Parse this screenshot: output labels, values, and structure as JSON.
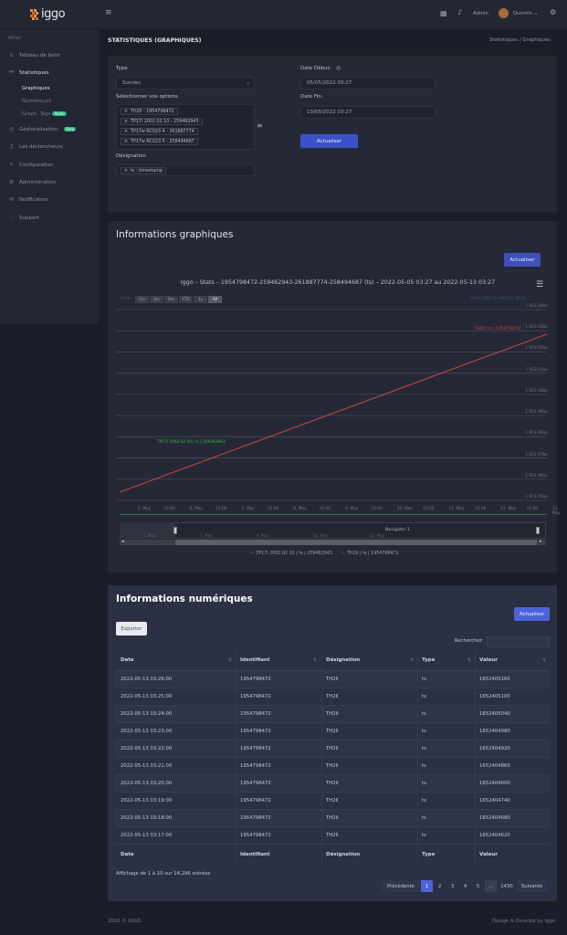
{
  "app": {
    "logo": "iggo"
  },
  "sidebar": {
    "menu_title": "MENU",
    "items": [
      {
        "label": "Tableau de bord",
        "icon": "home-icon"
      },
      {
        "label": "Statistiques",
        "icon": "chart-icon"
      },
      {
        "label": "Géolocalisation",
        "icon": "location-icon",
        "badge": "Beta"
      },
      {
        "label": "Les déclencheurs",
        "icon": "bell-icon"
      },
      {
        "label": "Configuration",
        "icon": "wrench-icon"
      },
      {
        "label": "Administration",
        "icon": "gear-icon"
      },
      {
        "label": "Notification",
        "icon": "mail-icon"
      },
      {
        "label": "Support",
        "icon": "lifebuoy-icon"
      }
    ],
    "sub_items": [
      {
        "label": "Graphiques"
      },
      {
        "label": "Numériques"
      },
      {
        "label": "Graph. Tags",
        "badge": "Alpha"
      }
    ]
  },
  "topbar": {
    "user": "Admin",
    "account": "Quentin"
  },
  "page": {
    "title": "STATISTIQUES (GRAPHIQUES)",
    "breadcrumb": "Statistiques  /  Graphiques"
  },
  "filters": {
    "type_label": "Type",
    "type_value": "Sondes",
    "options_label": "Sélectionner vos options",
    "options": [
      "TH2Il - 1954798472",
      "TP17l 2002 02 10 - 259462943",
      "TP17w RC023 4 - 261887774",
      "TP17w RC023 5 - 258494687"
    ],
    "designation_label": "Désignation",
    "designation_value": "ts : timestamp",
    "start_label": "Date Début:",
    "start_value": "05/05/2022 03:27",
    "end_label": "Date Fin:",
    "end_value": "13/05/2022 03:27",
    "submit": "Actualiser"
  },
  "graph_card": {
    "title": "Informations graphiques",
    "refresh": "Actualiser",
    "zoom_label": "Zoom",
    "zoom_buttons": [
      "1m",
      "3m",
      "6m",
      "YTD",
      "1y",
      "All"
    ],
    "from_to": "From   2022   To   May 13, 2022",
    "navigator_label": "Navigator 1"
  },
  "chart_data": {
    "type": "line",
    "title": "Iggo – Stats – 1954798472-259462943-261887774-258494687 (ts) – 2022-05-05 03:27 au 2022-05-13 03:27",
    "xlabel": "",
    "ylabel": "",
    "x_ticks": [
      "5. May",
      "12:00",
      "6. May",
      "12:00",
      "7. May",
      "12:00",
      "8. May",
      "12:00",
      "9. May",
      "12:00",
      "10. May",
      "12:00",
      "11. May",
      "12:00",
      "12. May",
      "12:00",
      "13. May"
    ],
    "y_ticks": [
      "1 651.95bn",
      "1 651.96bn",
      "1 651.97bn",
      "1 651.98bn",
      "1 651.99bn",
      "1 652.00bn",
      "1 652.01bn",
      "1 652.02bn",
      "1 652.03bn",
      "1 652.04bn"
    ],
    "ylim": [
      1651950000000,
      1652040000000
    ],
    "grid": true,
    "legend": "bottom",
    "series": [
      {
        "name": "TP17l 2002 02 10 | ts | 259462943",
        "color": "#3fb54a",
        "x": [
          0,
          8
        ],
        "values": [
          1651720000000,
          1652412000000
        ]
      },
      {
        "name": "TH2Il | ts | 1954798472",
        "color": "#d9483b",
        "x": [
          0,
          8
        ],
        "values": [
          1651950000000,
          1652040000000
        ]
      }
    ],
    "annotations": [
      "TH2Il | ts | 1954798472",
      "TP17l 2002 02 10 | ts | 259462943"
    ],
    "navigator_ticks": [
      "5. May",
      "7. May",
      "9. May",
      "11. May",
      "13. May"
    ]
  },
  "num_card": {
    "title": "Informations numériques",
    "refresh": "Actualiser",
    "export": "Exporter",
    "search_label": "Rechercher:",
    "columns": [
      "Date",
      "Identifiant",
      "Désignation",
      "Type",
      "Valeur"
    ],
    "rows": [
      [
        "2022-05-13 03:26:00",
        "1954798472",
        "TH2Il",
        "ts",
        "1652405160"
      ],
      [
        "2022-05-13 03:25:00",
        "1954798472",
        "TH2Il",
        "ts",
        "1652405100"
      ],
      [
        "2022-05-13 03:24:00",
        "1954798472",
        "TH2Il",
        "ts",
        "1652405040"
      ],
      [
        "2022-05-13 03:23:00",
        "1954798472",
        "TH2Il",
        "ts",
        "1652404980"
      ],
      [
        "2022-05-13 03:22:00",
        "1954798472",
        "TH2Il",
        "ts",
        "1652404920"
      ],
      [
        "2022-05-13 03:21:00",
        "1954798472",
        "TH2Il",
        "ts",
        "1652404860"
      ],
      [
        "2022-05-13 03:20:00",
        "1954798472",
        "TH2Il",
        "ts",
        "1652404800"
      ],
      [
        "2022-05-13 03:19:00",
        "1954798472",
        "TH2Il",
        "ts",
        "1652404740"
      ],
      [
        "2022-05-13 03:18:00",
        "1954798472",
        "TH2Il",
        "ts",
        "1652404680"
      ],
      [
        "2022-05-13 03:17:00",
        "1954798472",
        "TH2Il",
        "ts",
        "1652404620"
      ]
    ],
    "info": "Affichage de 1 à 10 sur 14,296 entrées",
    "pagination": [
      "Précédente",
      "1",
      "2",
      "3",
      "4",
      "5",
      "...",
      "1430",
      "Suivante"
    ]
  },
  "footer": {
    "left": "2022 © IGGO.",
    "right": "Design & Develop by Iggo"
  }
}
